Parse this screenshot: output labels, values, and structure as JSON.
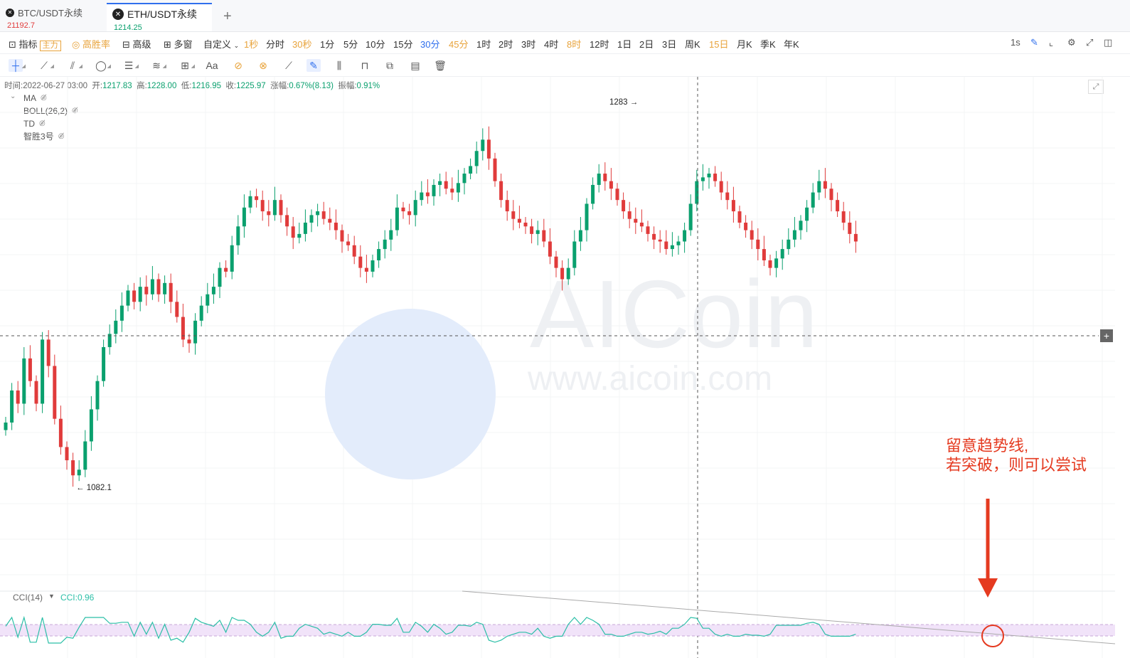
{
  "tabs": [
    {
      "symbol": "BTC/USDT永续",
      "price": "21192.7",
      "active": false
    },
    {
      "symbol": "ETH/USDT永续",
      "price": "1214.25",
      "active": true
    }
  ],
  "add_tab_glyph": "+",
  "periodbar": {
    "indicator_label": "指标",
    "indicator_badge": "主力",
    "winrate_label": "高胜率",
    "advanced_label": "高级",
    "multiwindow_label": "多窗",
    "custom_label": "自定义",
    "periods": [
      "1秒",
      "分时",
      "30秒",
      "1分",
      "5分",
      "10分",
      "15分",
      "30分",
      "45分",
      "1时",
      "2时",
      "3时",
      "4时",
      "8时",
      "12时",
      "1日",
      "2日",
      "3日",
      "周K",
      "15日",
      "月K",
      "季K",
      "年K"
    ],
    "selected_period": "30分",
    "interval_readout": "1s"
  },
  "ohlc": {
    "time_label": "时间:",
    "time": "2022-06-27 03:00",
    "open_label": "开:",
    "open": "1217.83",
    "high_label": "高:",
    "high": "1228.00",
    "low_label": "低:",
    "low": "1216.95",
    "close_label": "收:",
    "close": "1225.97",
    "change_label": "涨幅:",
    "change": "0.67%(8.13)",
    "amp_label": "振幅:",
    "amp": "0.91%"
  },
  "indicators": [
    "MA",
    "BOLL(26,2)",
    "TD",
    "智胜3号"
  ],
  "chart_data": {
    "type": "candlestick",
    "symbol": "ETH/USDT永续",
    "interval": "30分",
    "max_label": "1283",
    "min_label": "1082.1",
    "high_marker": 1283,
    "low_marker": 1082.1,
    "watermark": "AICoin",
    "watermark_url": "www.aicoin.com",
    "closes": [
      1118,
      1135,
      1128,
      1152,
      1140,
      1128,
      1162,
      1148,
      1120,
      1105,
      1098,
      1090,
      1093,
      1108,
      1125,
      1140,
      1158,
      1165,
      1172,
      1180,
      1188,
      1182,
      1190,
      1186,
      1194,
      1186,
      1192,
      1182,
      1174,
      1162,
      1160,
      1172,
      1180,
      1186,
      1190,
      1200,
      1198,
      1212,
      1222,
      1232,
      1238,
      1236,
      1230,
      1228,
      1236,
      1228,
      1222,
      1216,
      1218,
      1224,
      1228,
      1230,
      1226,
      1224,
      1220,
      1214,
      1212,
      1206,
      1200,
      1198,
      1204,
      1210,
      1215,
      1220,
      1232,
      1230,
      1228,
      1236,
      1240,
      1238,
      1244,
      1246,
      1242,
      1240,
      1245,
      1250,
      1254,
      1262,
      1268,
      1258,
      1246,
      1236,
      1230,
      1226,
      1224,
      1222,
      1218,
      1220,
      1214,
      1206,
      1200,
      1194,
      1200,
      1214,
      1220,
      1234,
      1244,
      1250,
      1246,
      1242,
      1236,
      1230,
      1226,
      1224,
      1222,
      1218,
      1215,
      1214,
      1210,
      1212,
      1214,
      1220,
      1234,
      1246,
      1248,
      1250,
      1246,
      1240,
      1236,
      1230,
      1224,
      1220,
      1215,
      1210,
      1204,
      1200,
      1205,
      1210,
      1215,
      1220,
      1225,
      1232,
      1240,
      1246,
      1242,
      1236,
      1230,
      1224,
      1218,
      1214
    ],
    "cci_label": "CCI(14)",
    "cci_value": "CCI:0.96",
    "cci_range": [
      -100,
      100
    ]
  },
  "annotation": {
    "line1": "留意趋势线,",
    "line2": "若突破，则可以尝试"
  },
  "colors": {
    "up": "#0aa06e",
    "down": "#e03b3b",
    "accent": "#2f6fed",
    "annotation": "#e53a20",
    "cci": "#2bbfa7"
  }
}
